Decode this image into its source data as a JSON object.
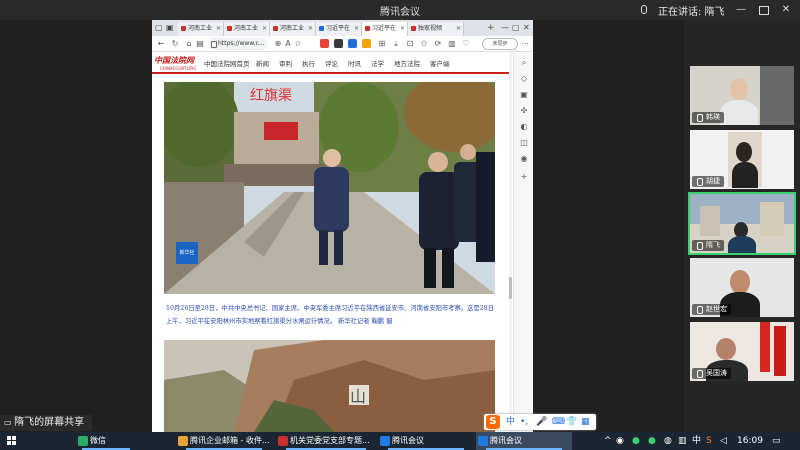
{
  "window": {
    "title": "腾讯会议",
    "speaking": "正在讲话: 隋飞"
  },
  "browser": {
    "tabs": [
      {
        "label": "河南工业",
        "color": "red"
      },
      {
        "label": "河南工业",
        "color": "red"
      },
      {
        "label": "河南工业",
        "color": "red"
      },
      {
        "label": "习近平在",
        "color": "blue"
      },
      {
        "label": "习近平在",
        "color": "red"
      },
      {
        "label": "独家视频",
        "color": "red"
      }
    ],
    "url": "https://www.c...",
    "profile": "未同步",
    "new_tab": "+"
  },
  "site": {
    "logo": "中国法院网",
    "logo_sub": "CHINACOURT.ORG",
    "nav": [
      "中国法院网首页",
      "新闻",
      "审判",
      "执行",
      "评论",
      "时讯",
      "法学",
      "地方法院",
      "客户端"
    ],
    "photo_sign": "红旗渠",
    "caption": "10月26日至28日，中共中央总书记、国家主席、中央军委主席习近平在陕西省延安市、河南省安阳市考察。这是28日上午，习近平在安阳林州市实地察看红旗渠分水闸运行情况。 新华社记者 鞠鹏 摄",
    "watermark": "新华社",
    "photo2_text": "山"
  },
  "sogou": {
    "items": [
      "中",
      "•,",
      "🎤",
      "⌨",
      "👕",
      "▦"
    ]
  },
  "share_label": "隋飞的屏幕共享",
  "participants": [
    {
      "name": "韩瑛"
    },
    {
      "name": "胡捷"
    },
    {
      "name": "隋飞"
    },
    {
      "name": "赵世宏"
    },
    {
      "name": "吴国涛"
    }
  ],
  "taskbar": {
    "items": [
      {
        "label": "微信",
        "color": "#2aae67"
      },
      {
        "label": "腾讯企业邮箱 - 收件...",
        "color": "#e9a23b"
      },
      {
        "label": "机关党委党支部专题...",
        "color": "#c9302c"
      },
      {
        "label": "腾讯会议",
        "color": "#1e7be6"
      },
      {
        "label": "腾讯会议",
        "color": "#1e7be6"
      }
    ],
    "ime": "中",
    "time": "16:09"
  },
  "colors": {
    "accent_green": "#3bd16f",
    "site_red": "#c81e1e",
    "caption_blue": "#2a4bb0"
  }
}
